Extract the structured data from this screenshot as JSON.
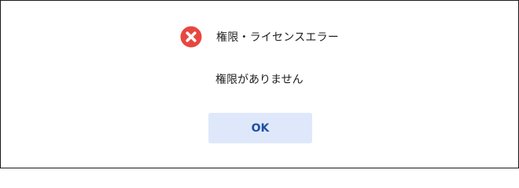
{
  "dialog": {
    "title": "権限・ライセンスエラー",
    "message": "権限がありません",
    "ok_label": "OK",
    "icon": "error-x-icon",
    "colors": {
      "icon_fill": "#e8473f",
      "icon_mark": "#ffffff",
      "button_bg": "#dfe8fb",
      "button_text": "#1f4fa3",
      "border": "#1a1a1a"
    }
  }
}
